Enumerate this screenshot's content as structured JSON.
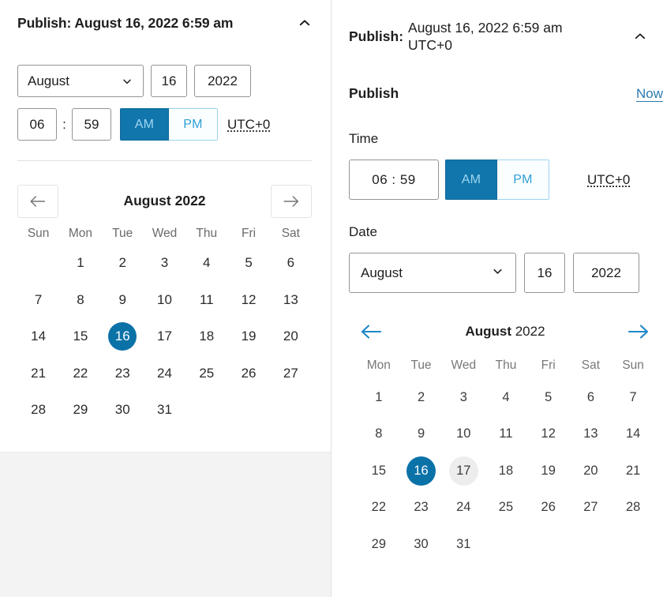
{
  "left_panel": {
    "header": {
      "title": "Publish: August 16, 2022 6:59 am",
      "collapse_icon": "chevron-up-icon"
    },
    "date_row": {
      "month": "August",
      "month_dropdown_icon": "chevron-down-icon",
      "day": "16",
      "year": "2022"
    },
    "time_row": {
      "hours": "06",
      "separator": ":",
      "minutes": "59",
      "am_label": "AM",
      "pm_label": "PM",
      "selected_meridiem": "AM",
      "timezone": "UTC+0"
    },
    "calendar": {
      "prev_icon": "arrow-left-icon",
      "next_icon": "arrow-right-icon",
      "title": "August 2022",
      "weekdays": [
        "Sun",
        "Mon",
        "Tue",
        "Wed",
        "Thu",
        "Fri",
        "Sat"
      ],
      "leading_blanks": 1,
      "days": [
        1,
        2,
        3,
        4,
        5,
        6,
        7,
        8,
        9,
        10,
        11,
        12,
        13,
        14,
        15,
        16,
        17,
        18,
        19,
        20,
        21,
        22,
        23,
        24,
        25,
        26,
        27,
        28,
        29,
        30,
        31
      ],
      "selected_day": 16
    }
  },
  "right_panel": {
    "header": {
      "label": "Publish:",
      "value": "August 16, 2022 6:59 am UTC+0",
      "collapse_icon": "chevron-up-icon"
    },
    "publish_row": {
      "label": "Publish",
      "now_label": "Now"
    },
    "time_section": {
      "label": "Time",
      "time_value": "06 : 59",
      "am_label": "AM",
      "pm_label": "PM",
      "selected_meridiem": "AM",
      "timezone": "UTC+0"
    },
    "date_section": {
      "label": "Date",
      "month": "August",
      "month_dropdown_icon": "chevron-down-icon",
      "day": "16",
      "year": "2022"
    },
    "calendar": {
      "prev_icon": "arrow-left-icon",
      "next_icon": "arrow-right-icon",
      "title_month": "August",
      "title_year": "2022",
      "weekdays": [
        "Mon",
        "Tue",
        "Wed",
        "Thu",
        "Fri",
        "Sat",
        "Sun"
      ],
      "leading_blanks": 0,
      "days": [
        1,
        2,
        3,
        4,
        5,
        6,
        7,
        8,
        9,
        10,
        11,
        12,
        13,
        14,
        15,
        16,
        17,
        18,
        19,
        20,
        21,
        22,
        23,
        24,
        25,
        26,
        27,
        28,
        29,
        30,
        31
      ],
      "selected_day": 16,
      "today_day": 17
    }
  },
  "colors": {
    "accent_blue": "#0b72a8",
    "toggle_on_bg": "#1076ac",
    "toggle_on_text": "#9fd6f2",
    "toggle_off_text": "#2f9fd6",
    "link_blue": "#2a7bb0",
    "arrow_blue": "#1e88c7",
    "today_bg": "#ededed",
    "panel_gray": "#f3f3f3",
    "border_gray": "#949494"
  }
}
